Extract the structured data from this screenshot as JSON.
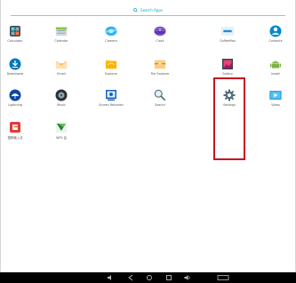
{
  "search": {
    "label": "Search Apps"
  },
  "apps": [
    {
      "id": "calculator",
      "label": "Calculator",
      "icon": "calculator-icon"
    },
    {
      "id": "calendar",
      "label": "Calendar",
      "icon": "calendar-icon"
    },
    {
      "id": "camera",
      "label": "Camera",
      "icon": "camera-icon"
    },
    {
      "id": "clock",
      "label": "Clock",
      "icon": "clock-icon"
    },
    {
      "id": "coffeemax",
      "label": "CoffeeMax",
      "icon": "coffeemax-icon"
    },
    {
      "id": "contacts",
      "label": "Contacts",
      "icon": "contacts-icon"
    },
    {
      "id": "downloads",
      "label": "Downloads",
      "icon": "downloads-icon"
    },
    {
      "id": "email",
      "label": "Email",
      "icon": "email-icon"
    },
    {
      "id": "explorer",
      "label": "Explorer",
      "icon": "explorer-icon"
    },
    {
      "id": "file-explorer",
      "label": "File Explorer",
      "icon": "file-explorer-icon"
    },
    {
      "id": "gallery",
      "label": "Gallery",
      "icon": "gallery-icon"
    },
    {
      "id": "install",
      "label": "Install",
      "icon": "android-icon"
    },
    {
      "id": "lightning",
      "label": "Lightning",
      "icon": "umbrella-icon"
    },
    {
      "id": "music",
      "label": "Music",
      "icon": "music-disc-icon"
    },
    {
      "id": "screen-recorder",
      "label": "Screen Recorder",
      "icon": "screen-recorder-icon"
    },
    {
      "id": "search",
      "label": "Search",
      "icon": "magnifier-icon"
    },
    {
      "id": "settings",
      "label": "Settings",
      "icon": "gear-icon"
    },
    {
      "id": "video",
      "label": "Video",
      "icon": "video-icon"
    },
    {
      "id": "sogou",
      "label": "搜狗输入法",
      "icon": "sogou-icon"
    },
    {
      "id": "wps",
      "label": "WPS 会",
      "icon": "wps-icon"
    }
  ],
  "colors": {
    "accent": "#1aa3b8",
    "highlight": "#c8111e",
    "navbar": "#000000"
  },
  "navbar": [
    "volume-down-icon",
    "back-icon",
    "home-icon",
    "recents-icon",
    "volume-up-icon",
    "screenshot-icon"
  ]
}
